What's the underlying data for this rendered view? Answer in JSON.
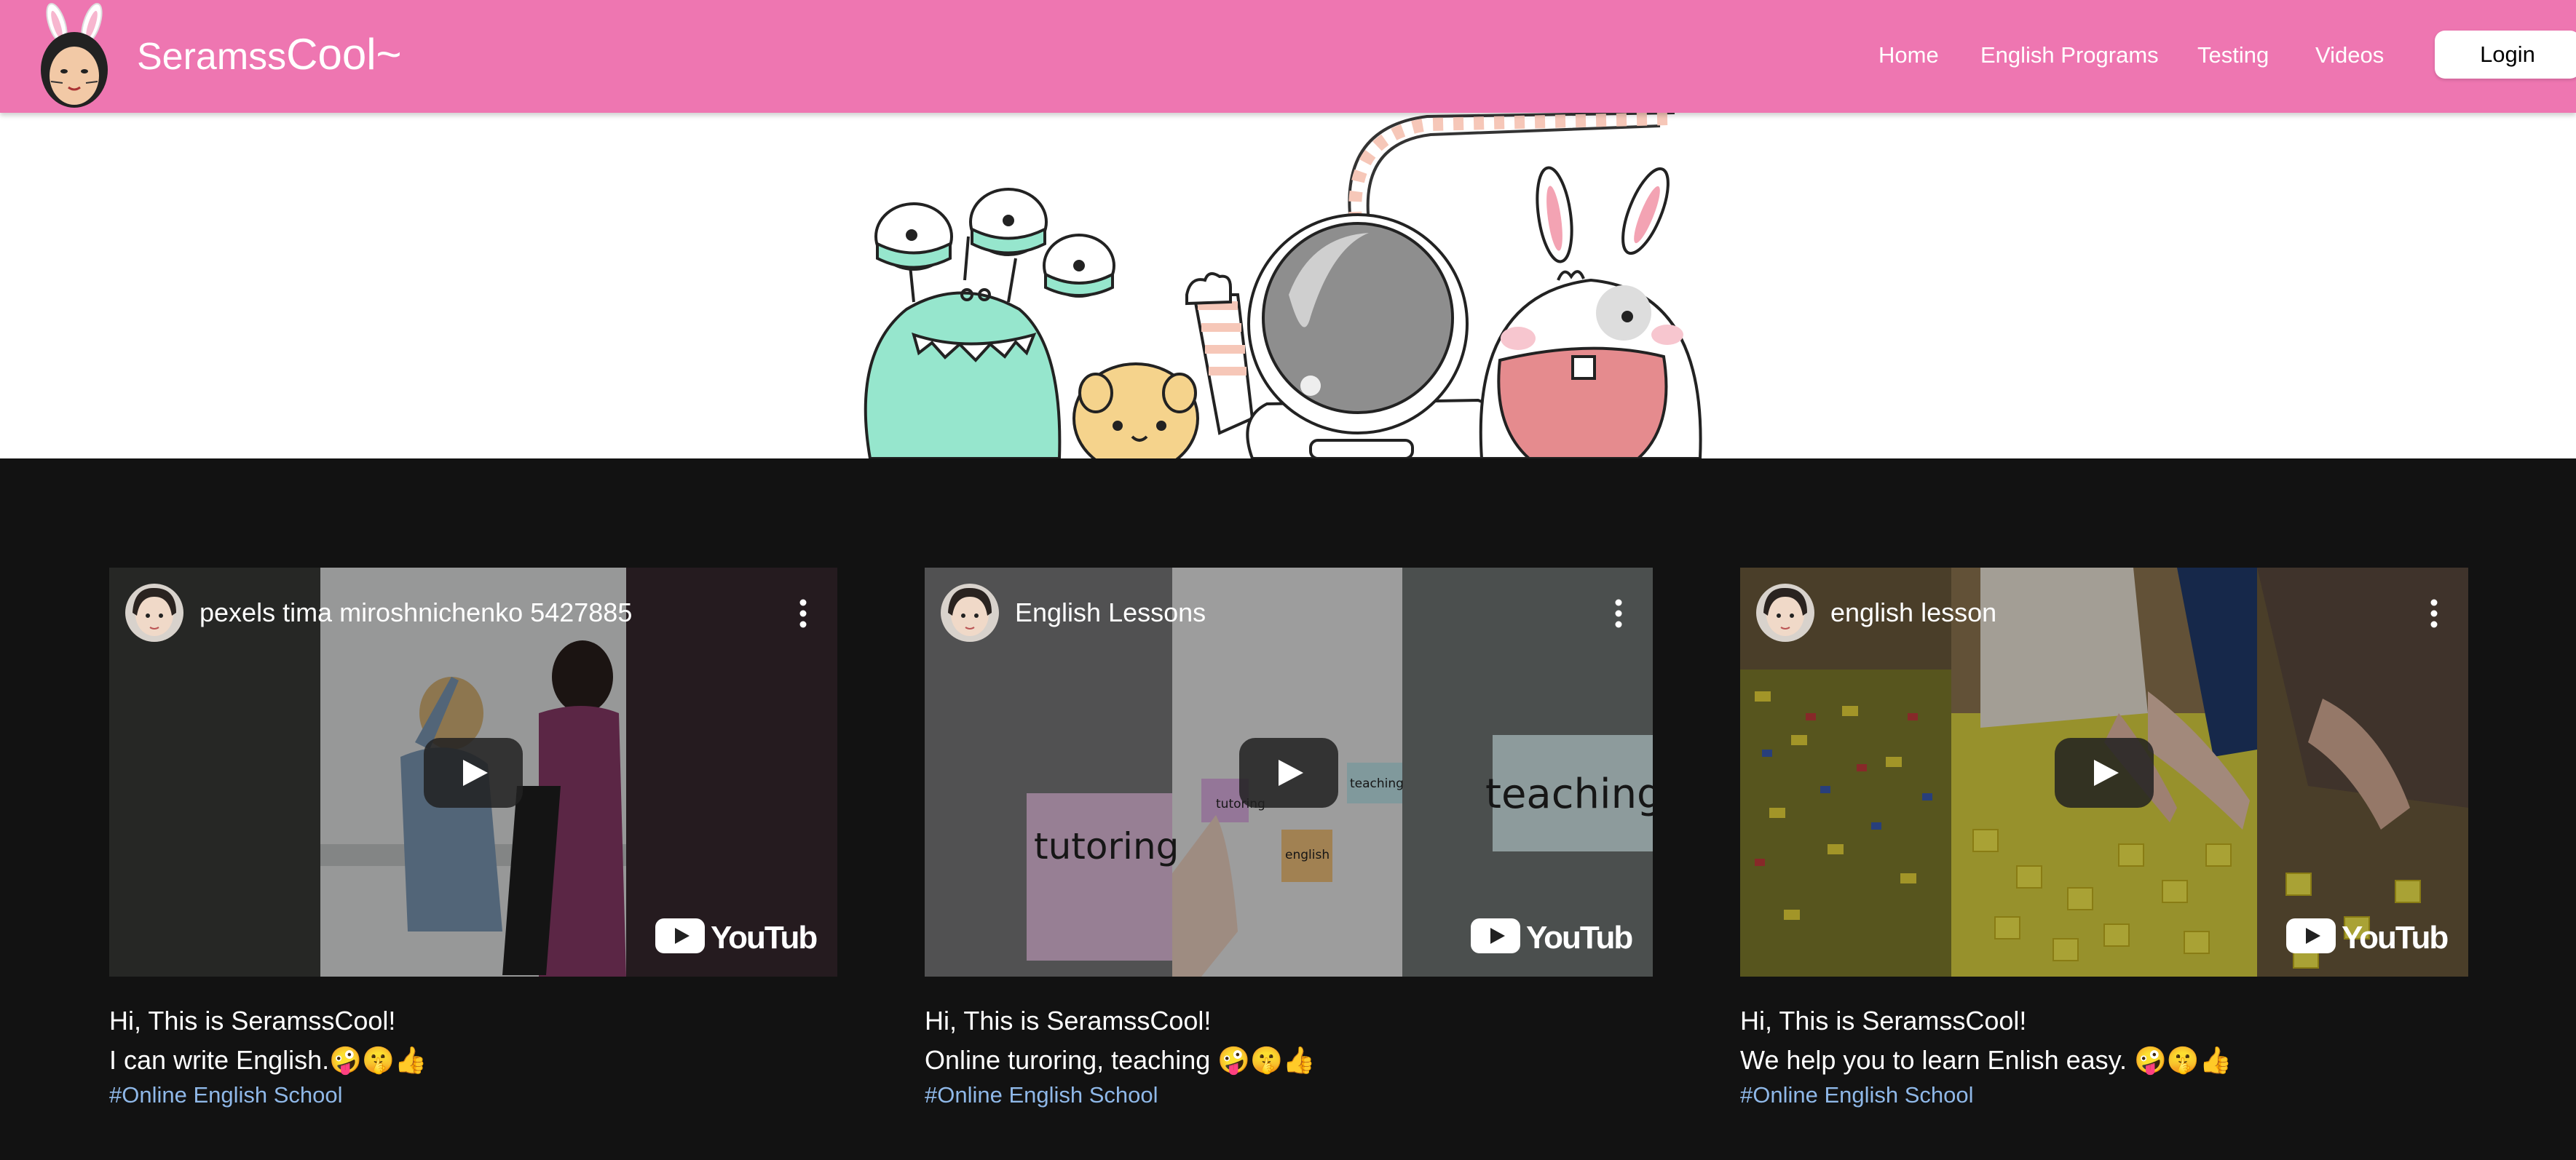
{
  "brand": {
    "name_small": "Seramss",
    "name_big": "Cool~"
  },
  "nav": {
    "links": [
      "Home",
      "English Programs",
      "Testing",
      "Videos"
    ],
    "login_label": "Login"
  },
  "colors": {
    "navbar": "#ee76b1",
    "page_bg": "#121212",
    "hashtag": "#8fb8e8"
  },
  "videos": [
    {
      "title": "pexels tima miroshnichenko 5427885",
      "caption_line1": "Hi, This is SeramssCool!",
      "caption_line2": "I can write English.🤪🤫👍",
      "hashtag": "#Online English School",
      "logo": "YouTube"
    },
    {
      "title": "English Lessons",
      "caption_line1": "Hi, This is SeramssCool!",
      "caption_line2": "Online turoring, teaching 🤪🤫👍",
      "hashtag": "#Online English School",
      "logo": "YouTube",
      "notes": [
        "tutoring",
        "teaching",
        "english"
      ]
    },
    {
      "title": "english lesson",
      "caption_line1": "Hi, This is SeramssCool!",
      "caption_line2": "We help you to learn Enlish easy. 🤪🤫👍",
      "hashtag": "#Online English School",
      "logo": "YouTube"
    }
  ]
}
